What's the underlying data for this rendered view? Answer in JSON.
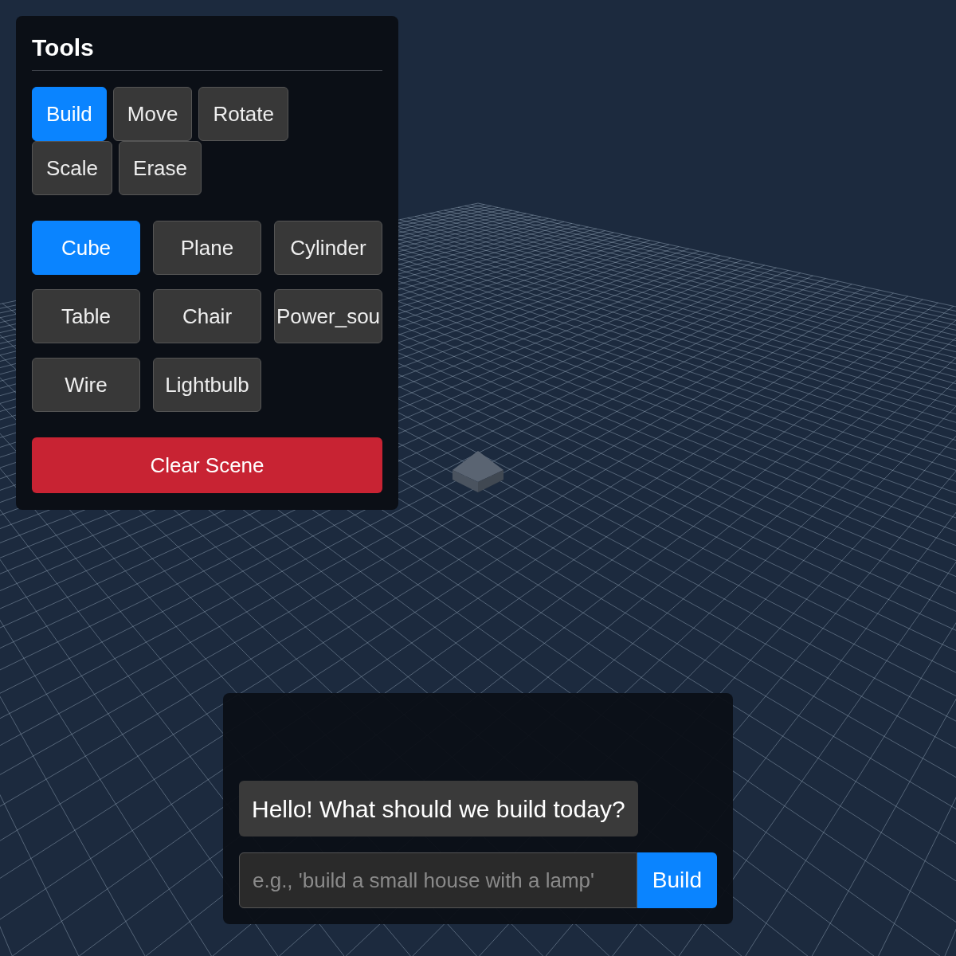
{
  "tools_panel": {
    "title": "Tools",
    "modes": [
      {
        "label": "Build",
        "selected": true
      },
      {
        "label": "Move",
        "selected": false
      },
      {
        "label": "Rotate",
        "selected": false
      },
      {
        "label": "Scale",
        "selected": false
      },
      {
        "label": "Erase",
        "selected": false
      }
    ],
    "objects": [
      {
        "label": "Cube",
        "selected": true
      },
      {
        "label": "Plane",
        "selected": false
      },
      {
        "label": "Cylinder",
        "selected": false
      },
      {
        "label": "Table",
        "selected": false
      },
      {
        "label": "Chair",
        "selected": false
      },
      {
        "label": "Power_sou",
        "selected": false
      },
      {
        "label": "Wire",
        "selected": false
      },
      {
        "label": "Lightbulb",
        "selected": false
      }
    ],
    "clear_button": "Clear Scene"
  },
  "chat": {
    "messages": [
      {
        "text": "Hello! What should we build today?"
      }
    ],
    "input": {
      "placeholder": "e.g., 'build a small house with a lamp'"
    },
    "send_button": "Build"
  }
}
